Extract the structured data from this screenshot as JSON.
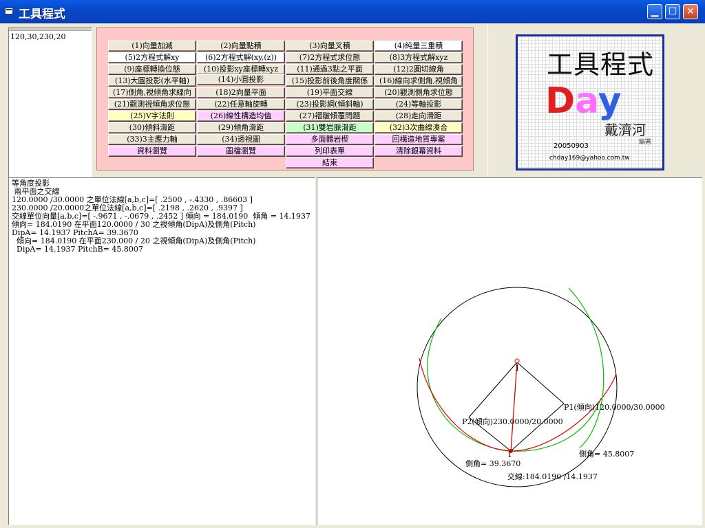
{
  "window": {
    "title": "工具程式"
  },
  "input": {
    "value": "120,30,230,20"
  },
  "buttons": {
    "r1": [
      "(1)向量加減",
      "(2)向量點積",
      "(3)向量叉積",
      "(4)純量三重積"
    ],
    "r2": [
      "(5)2方程式解xy",
      "(6)2方程式解(xy,(z))",
      "(7)2方程式求位態",
      "(8)3方程式解xyz"
    ],
    "r3": [
      "(9)座標轉換位態",
      "(10)投影xy座標轉xyz",
      "(11)通過3點之平面",
      "(12)2圓切線角"
    ],
    "r4": [
      "(13)大圓投影(水平軸)",
      "(14)小圓投影",
      "(15)投影前後角度關係",
      "(16)線向求側角,視傾角"
    ],
    "r5": [
      "(17)側角,視傾角求線向",
      "(18)2向量平面",
      "(19)平面交線",
      "(20)觀測側角求位態"
    ],
    "r6": [
      "(21)觀測視傾角求位態",
      "(22)任意軸旋轉",
      "(23)投影網(傾斜軸)",
      "(24)等軸投影"
    ],
    "r7": [
      "(25)V字法則",
      "(26)線性構造均值",
      "(27)褶皺傾覆問題",
      "(28)走向滑距"
    ],
    "r8": [
      "(30)傾斜滑距",
      "(29)傾角滑距",
      "(31)雙岩脈滑距",
      "(32)3次曲線湊合"
    ],
    "r9": [
      "(33)3主應力軸",
      "(34)透視圖",
      "多面體岩楔",
      "回構造地質專案"
    ],
    "r10": [
      "資料瀏覽",
      "圖檔瀏覽",
      "列印表單",
      "清除銀幕資料"
    ],
    "r11": [
      "結束"
    ]
  },
  "logo": {
    "title": "工具程式",
    "brand": "Day",
    "author": "戴濟河",
    "edit": "編著",
    "date": "20050903",
    "email": "chday169@yahoo.com.tw"
  },
  "output": {
    "lines": [
      "等角度投影",
      " 兩平面之交線",
      "120.0000 /30.0000 之單位法線[a,b,c]=[ .2500 , -.4330 , .86603 ]",
      "230.0000 /20.0000之單位法線[a,b,c]=[ .2198 , .2620 , .9397 ]",
      "交線單位向量[a,b,c]=[ -.9671 , -.0679 , .2452 ] 傾向 = 184.0190  傾角 = 14.1937",
      "傾向= 184.0190 在平面120.0000 / 30 之視傾角(DipA)及側角(Pitch)",
      "DipA= 14.1937 PitchA= 39.3670",
      "  傾向= 184.0190 在平面230.000 / 20 之視傾角(DipA)及側角(Pitch)",
      "  DipA= 14.1937 PitchB= 45.8007"
    ]
  },
  "plot": {
    "label_top": "1",
    "label_bottom": "1",
    "p1": "P1(傾向)120.0000/30.0000",
    "p2": "P2(傾向)230.0000/20.0000",
    "pitch_a": "側角= 39.3670",
    "pitch_b": "側角= 45.8007",
    "intersection": "交線:184.0190 /14.1937",
    "colors": {
      "great_circle_1": "#00c000",
      "great_circle_2": "#e00000",
      "primitive": "#000000"
    }
  }
}
